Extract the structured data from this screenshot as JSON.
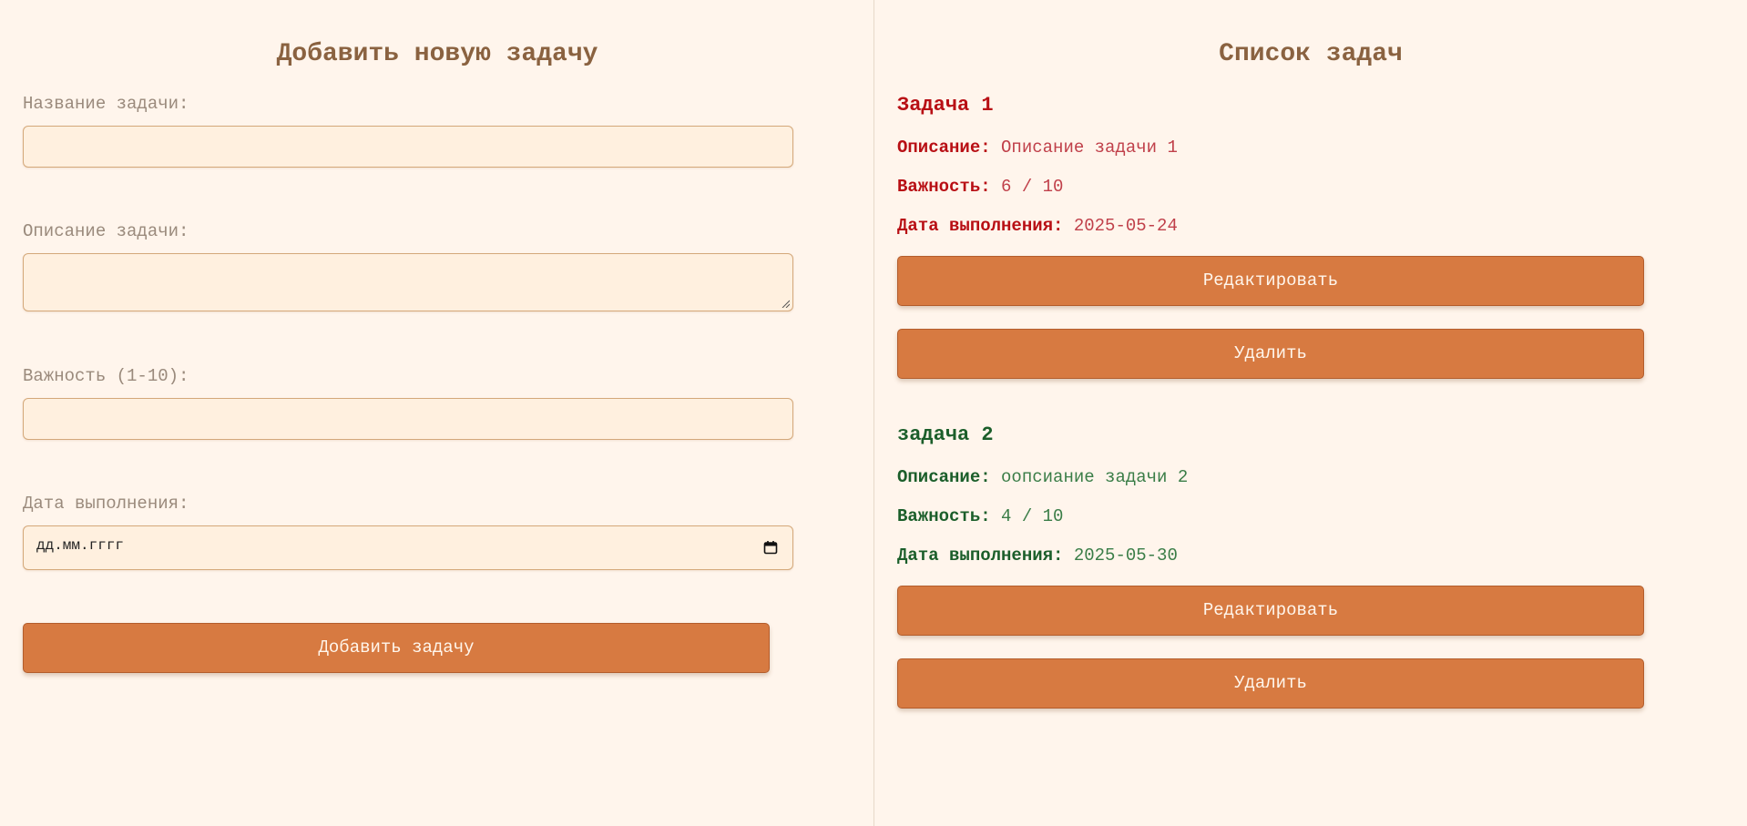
{
  "form": {
    "heading": "Добавить новую задачу",
    "title_label": "Название задачи:",
    "title_value": "",
    "description_label": "Описание задачи:",
    "description_value": "",
    "importance_label": "Важность (1-10):",
    "importance_value": "",
    "date_label": "Дата выполнения:",
    "date_placeholder": "дд.мм.гггг",
    "submit_label": "Добавить задачу"
  },
  "list": {
    "heading": "Список задач",
    "description_prefix": "Описание:",
    "importance_prefix": "Важность:",
    "date_prefix": "Дата выполнения:",
    "edit_label": "Редактировать",
    "delete_label": "Удалить",
    "tasks": [
      {
        "title": "Задача 1",
        "description": "Описание задачи 1",
        "importance": "6 / 10",
        "date": "2025-05-24",
        "label_color": "#b80f14",
        "value_color": "#c0404a"
      },
      {
        "title": "задача 2",
        "description": "оопсиание задачи 2",
        "importance": "4 / 10",
        "date": "2025-05-30",
        "label_color": "#1b5e2a",
        "value_color": "#3a7d47"
      }
    ]
  },
  "colors": {
    "background": "#fff5ec",
    "button": "#d77a41",
    "heading": "#8a6240",
    "input_bg": "#fff0df",
    "input_border": "#d4a87a"
  }
}
